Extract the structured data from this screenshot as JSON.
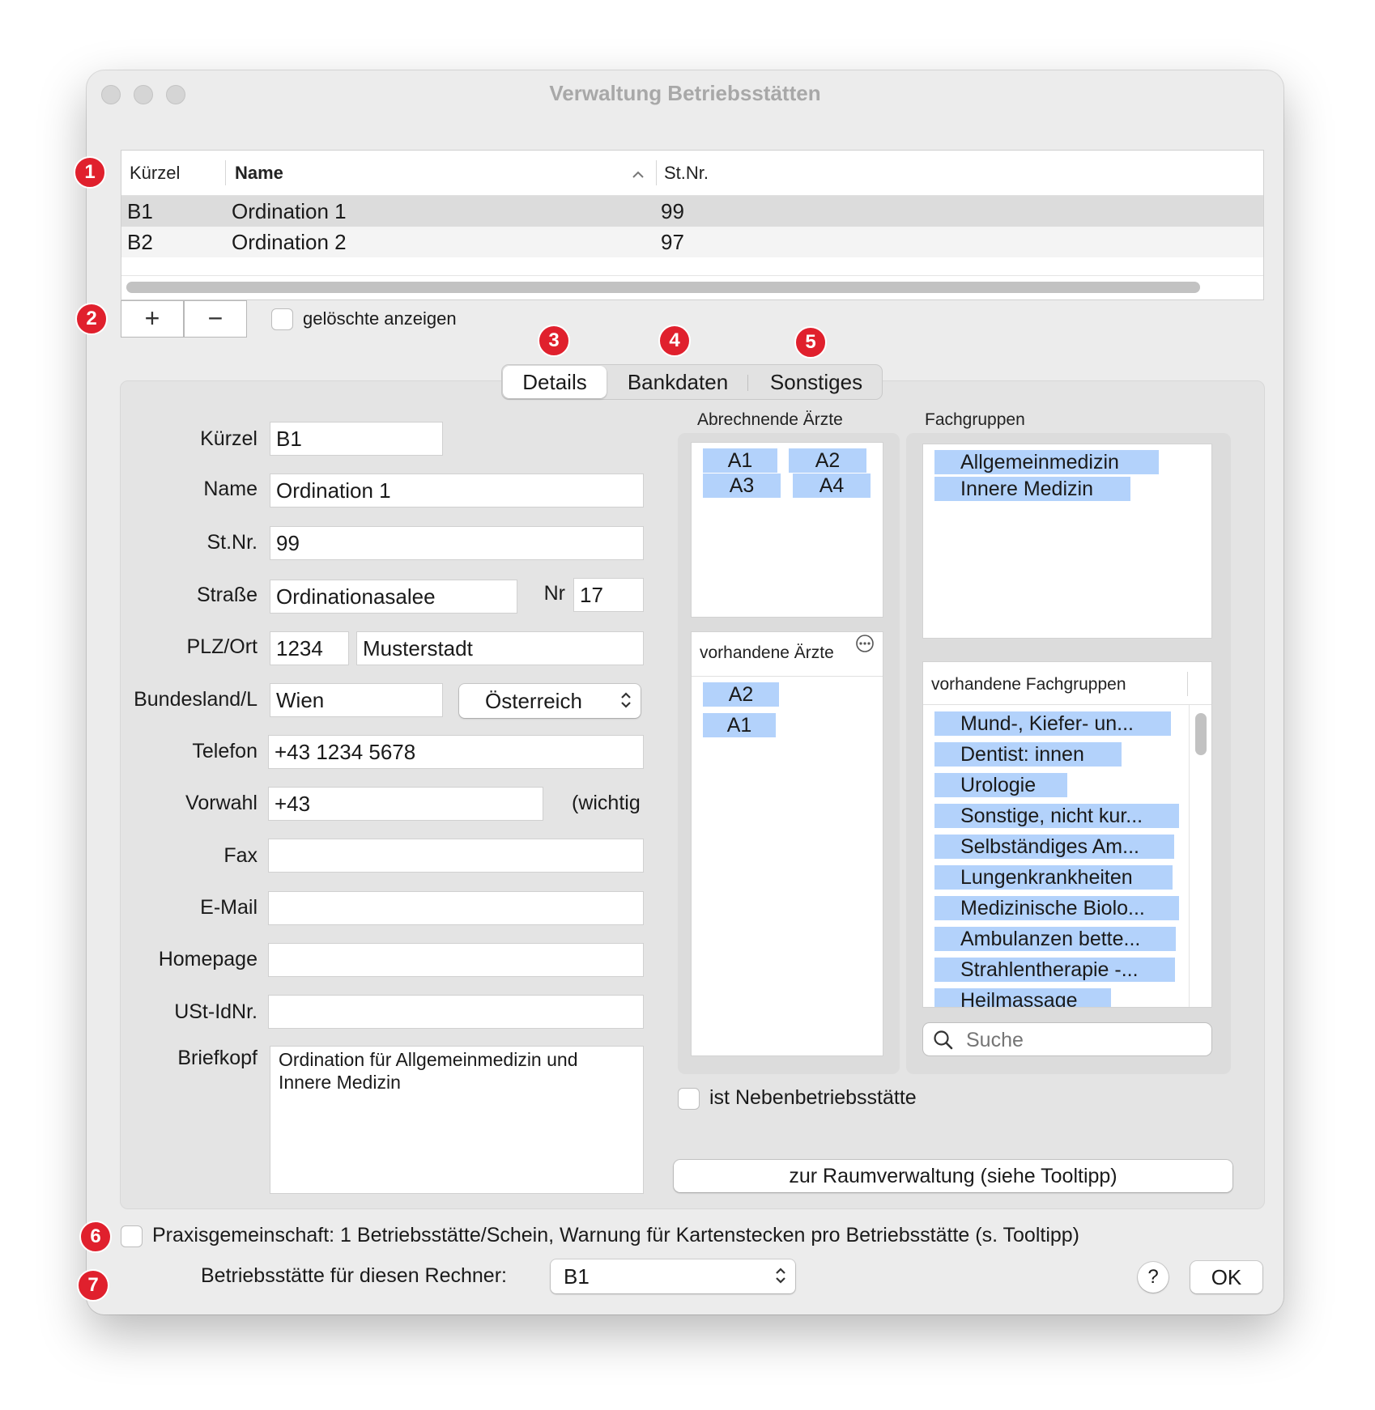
{
  "window": {
    "title": "Verwaltung Betriebsstätten"
  },
  "badges": [
    "1",
    "2",
    "3",
    "4",
    "5",
    "6",
    "7"
  ],
  "table": {
    "columns": [
      "Kürzel",
      "Name",
      "St.Nr."
    ],
    "sort_icon": "chevron-up-icon",
    "rows": [
      {
        "kuerzel": "B1",
        "name": "Ordination 1",
        "stnr": "99"
      },
      {
        "kuerzel": "B2",
        "name": "Ordination 2",
        "stnr": "97"
      }
    ]
  },
  "controls": {
    "add": "+",
    "remove": "−",
    "show_deleted": "gelöschte anzeigen"
  },
  "tabs": [
    "Details",
    "Bankdaten",
    "Sonstiges"
  ],
  "form": {
    "labels": {
      "kuerzel": "Kürzel",
      "name": "Name",
      "stnr": "St.Nr.",
      "strasse": "Straße",
      "nr": "Nr",
      "plzort": "PLZ/Ort",
      "bundesland": "Bundesland/L",
      "telefon": "Telefon",
      "vorwahl": "Vorwahl",
      "fax": "Fax",
      "email": "E-Mail",
      "homepage": "Homepage",
      "ustid": "USt-IdNr.",
      "briefkopf": "Briefkopf"
    },
    "values": {
      "kuerzel": "B1",
      "name": "Ordination 1",
      "stnr": "99",
      "strasse": "Ordinationasalee",
      "nr": "17",
      "plz": "1234",
      "ort": "Musterstadt",
      "bundesland": "Wien",
      "land": "Österreich",
      "telefon": "+43 1234 5678",
      "vorwahl": "+43",
      "vorwahl_hint": "(wichtig",
      "fax": "",
      "email": "",
      "homepage": "",
      "ustid": "",
      "briefkopf_line1": "Ordination für Allgemeinmedizin und",
      "briefkopf_line2": "Innere Medizin"
    }
  },
  "aerzte": {
    "title": "Abrechnende Ärzte",
    "assigned": [
      "A1",
      "A2",
      "A3",
      "A4"
    ],
    "available_title": "vorhandene Ärzte",
    "available": [
      "A2",
      "A1"
    ]
  },
  "fachgruppen": {
    "title": "Fachgruppen",
    "assigned": [
      "Allgemeinmedizin",
      "Innere Medizin"
    ],
    "available_title": "vorhandene Fachgruppen",
    "available": [
      "Mund-, Kiefer- un...",
      "Dentist: innen",
      "Urologie",
      "Sonstige, nicht kur...",
      "Selbständiges Am...",
      "Lungenkrankheiten",
      "Medizinische Biolo...",
      "Ambulanzen bette...",
      "Strahlentherapie -...",
      "Heilmassage"
    ],
    "search_placeholder": "Suche"
  },
  "nebenbetrieb": "ist Nebenbetriebsstätte",
  "raum_button": "zur Raumverwaltung (siehe Tooltipp)",
  "praxis_checkbox": "Praxisgemeinschaft: 1 Betriebsstätte/Schein, Warnung für Kartenstecken pro Betriebsstätte (s. Tooltipp)",
  "rechner": {
    "label": "Betriebsstätte für diesen Rechner:",
    "value": "B1"
  },
  "buttons": {
    "help": "?",
    "ok": "OK"
  }
}
